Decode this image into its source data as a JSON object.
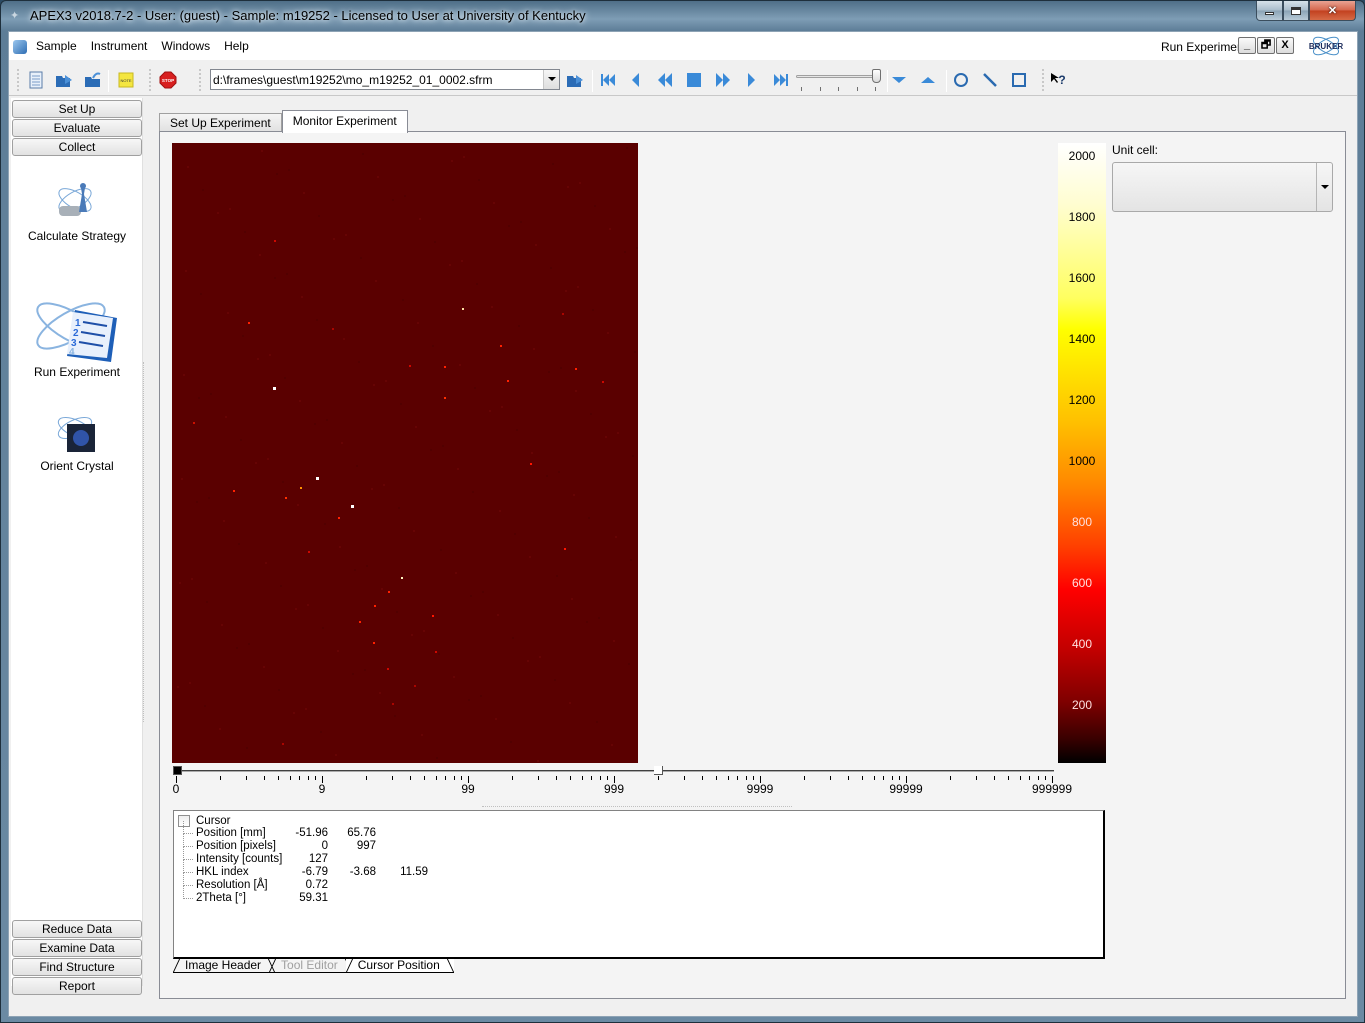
{
  "window": {
    "title": "APEX3 v2018.7-2 - User: (guest) - Sample: m19252 - Licensed to User at University of Kentucky",
    "controls": {
      "minimize": "minimize-icon",
      "maximize": "maximize-icon",
      "close": "close-icon"
    }
  },
  "menubar": {
    "items": [
      {
        "label": "Sample"
      },
      {
        "label": "Instrument"
      },
      {
        "label": "Windows"
      },
      {
        "label": "Help"
      }
    ],
    "current_tool": "Run Experiment",
    "mdi_buttons": [
      "_",
      "🗗",
      "X"
    ],
    "logo_text": "BRUKER"
  },
  "toolbar": {
    "file_icons": [
      "new-document-icon",
      "open-folder-icon",
      "open-recent-folder-icon"
    ],
    "note_icon": "note-icon",
    "note_label": "NOTE",
    "stop_icon": "stop-icon",
    "stop_label": "STOP",
    "frame_path": "d:\\frames\\guest\\m19252\\mo_m19252_01_0002.sfrm",
    "playback": [
      "first-frame-icon",
      "previous-frame-icon",
      "rewind-icon",
      "stop-playback-icon",
      "fast-forward-icon",
      "next-frame-icon",
      "last-frame-icon"
    ],
    "frame_slider_position": 1.0,
    "contrast_tools": [
      "decrease-icon",
      "increase-icon"
    ],
    "shape_tools": [
      "circle-tool-icon",
      "line-tool-icon",
      "rectangle-tool-icon"
    ],
    "help_icon": "context-help-icon"
  },
  "leftnav": {
    "top_buttons": [
      {
        "label": "Set Up"
      },
      {
        "label": "Evaluate"
      },
      {
        "label": "Collect"
      }
    ],
    "tools": [
      {
        "label": "Calculate Strategy",
        "icon": "calculate-strategy-icon"
      },
      {
        "label": "Run Experiment",
        "icon": "run-experiment-icon"
      },
      {
        "label": "Orient Crystal",
        "icon": "orient-crystal-icon"
      }
    ],
    "bottom_buttons": [
      {
        "label": "Reduce Data"
      },
      {
        "label": "Examine Data"
      },
      {
        "label": "Find Structure"
      },
      {
        "label": "Report"
      }
    ]
  },
  "main": {
    "tabs": [
      {
        "label": "Set Up Experiment",
        "active": false
      },
      {
        "label": "Monitor Experiment",
        "active": true
      }
    ],
    "colorbar": {
      "labels": [
        "2000",
        "1800",
        "1600",
        "1400",
        "1200",
        "1000",
        "800",
        "600",
        "400",
        "200"
      ],
      "colors": {
        "max": "#ffffff",
        "mid": "#ffff00",
        "low": "#ff0000",
        "min": "#000000"
      }
    },
    "unit_cell": {
      "label": "Unit cell:",
      "value": ""
    },
    "image": {
      "background_color": "#5a0000",
      "spots": [
        [
          290,
          165,
          "#ffe0a0"
        ],
        [
          76,
          179,
          "#ff2000"
        ],
        [
          328,
          202,
          "#ff2000"
        ],
        [
          272,
          223,
          "#ff2000"
        ],
        [
          101,
          244,
          "#ffffff"
        ],
        [
          272,
          254,
          "#ff3000"
        ],
        [
          335,
          237,
          "#ff2000"
        ],
        [
          403,
          225,
          "#ff2000"
        ],
        [
          21,
          279,
          "#cc1000"
        ],
        [
          144,
          334,
          "#ffffff"
        ],
        [
          128,
          344,
          "#ff9000"
        ],
        [
          113,
          354,
          "#ff3000"
        ],
        [
          61,
          347,
          "#ff2000"
        ],
        [
          179,
          362,
          "#ffffff"
        ],
        [
          166,
          374,
          "#ff2000"
        ],
        [
          358,
          320,
          "#ff1500"
        ],
        [
          392,
          405,
          "#ff1500"
        ],
        [
          229,
          434,
          "#fff4c0"
        ],
        [
          216,
          448,
          "#ff2000"
        ],
        [
          202,
          462,
          "#ff2000"
        ],
        [
          187,
          478,
          "#ff2000"
        ],
        [
          260,
          472,
          "#ff1500"
        ],
        [
          201,
          499,
          "#ff2000"
        ],
        [
          102,
          97,
          "#cc0800"
        ],
        [
          237,
          222,
          "#cc0800"
        ],
        [
          430,
          238,
          "#cc0800"
        ],
        [
          263,
          508,
          "#cc0800"
        ],
        [
          215,
          525,
          "#cc0800"
        ],
        [
          242,
          542,
          "#aa0500"
        ],
        [
          136,
          408,
          "#cc0800"
        ],
        [
          390,
          170,
          "#aa0500"
        ],
        [
          160,
          185,
          "#aa0500"
        ],
        [
          220,
          560,
          "#aa0500"
        ],
        [
          110,
          600,
          "#aa0500"
        ]
      ]
    },
    "scale": {
      "ticks": [
        "0",
        "9",
        "99",
        "999",
        "9999",
        "99999",
        "999999"
      ],
      "min_handle": 0,
      "max_handle": 1999
    },
    "cursor_panel": {
      "root_label": "Cursor",
      "checked": false,
      "rows": [
        {
          "key": "Position [mm]",
          "values": [
            "-51.96",
            "65.76"
          ]
        },
        {
          "key": "Position [pixels]",
          "values": [
            "0",
            "997"
          ]
        },
        {
          "key": "Intensity [counts]",
          "values": [
            "127"
          ]
        },
        {
          "key": "HKL index",
          "values": [
            "-6.79",
            "-3.68",
            "11.59"
          ]
        },
        {
          "key": "Resolution [Å]",
          "values": [
            "0.72"
          ]
        },
        {
          "key": "2Theta [°]",
          "values": [
            "59.31"
          ]
        }
      ]
    },
    "bottom_tabs": [
      {
        "label": "Image Header",
        "state": "normal"
      },
      {
        "label": "Tool Editor",
        "state": "disabled"
      },
      {
        "label": "Cursor Position",
        "state": "active"
      }
    ]
  }
}
